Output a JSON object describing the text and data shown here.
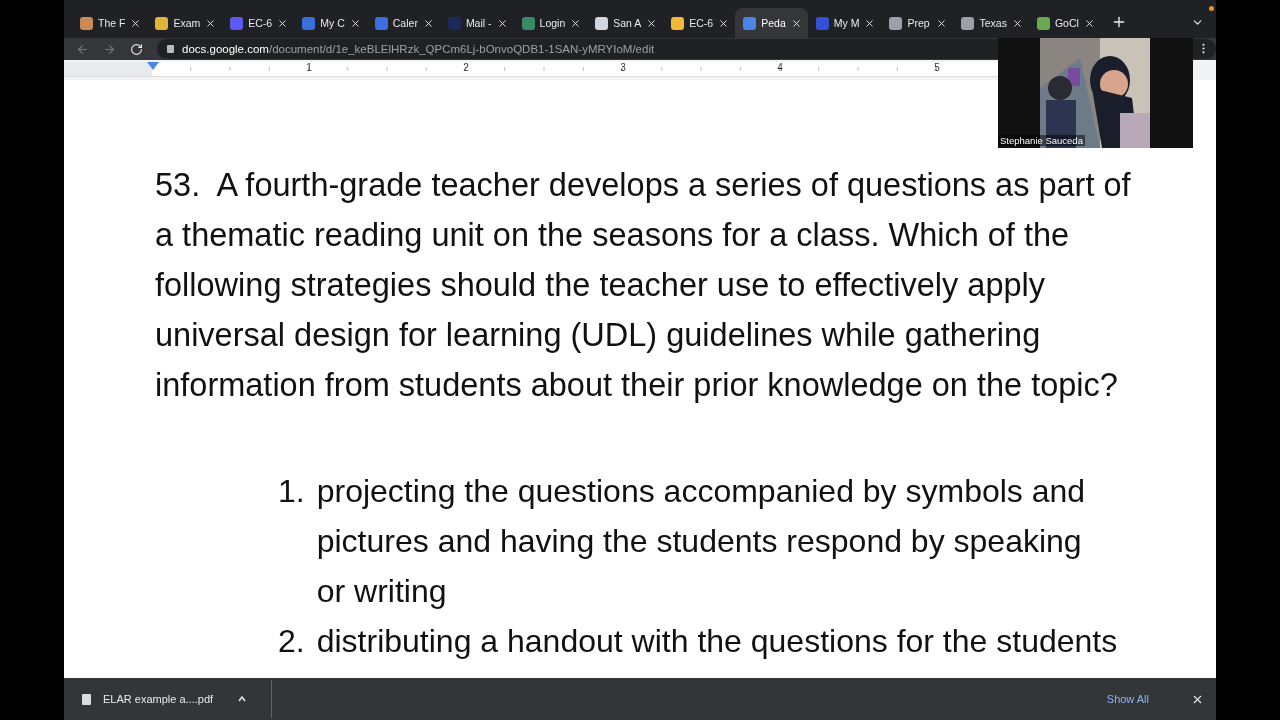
{
  "browser": {
    "tabs": [
      {
        "title": "The F",
        "selected": false,
        "color": "#c98a5a"
      },
      {
        "title": "Exam",
        "selected": false,
        "color": "#e0b43c"
      },
      {
        "title": "EC-6",
        "selected": false,
        "color": "#5b5bf0"
      },
      {
        "title": "My C",
        "selected": false,
        "color": "#3b6fe0"
      },
      {
        "title": "Caler",
        "selected": false,
        "color": "#3b6fe0"
      },
      {
        "title": "Mail -",
        "selected": false,
        "color": "#1c2a5a"
      },
      {
        "title": "Login",
        "selected": false,
        "color": "#3a8a6a"
      },
      {
        "title": "San A",
        "selected": false,
        "color": "#cfd6e0"
      },
      {
        "title": "EC-6",
        "selected": false,
        "color": "#f2b83a"
      },
      {
        "title": "Peda",
        "selected": true,
        "color": "#4a86e8"
      },
      {
        "title": "My M",
        "selected": false,
        "color": "#3550d8"
      },
      {
        "title": "Prep",
        "selected": false,
        "color": "#9aa0a6"
      },
      {
        "title": "Texas",
        "selected": false,
        "color": "#9aa0a6"
      },
      {
        "title": "GoCl",
        "selected": false,
        "color": "#6aa84f"
      }
    ],
    "address": {
      "host": "docs.google.com",
      "path": "/document/d/1e_keBLElHRzk_QPCm6Lj-bOnvoQDB1-1SAN-yMRYIoM/edit"
    }
  },
  "ruler": {
    "marks": [
      "1",
      "2",
      "3",
      "4",
      "5"
    ]
  },
  "document": {
    "question": "53.  A fourth-grade teacher develops a series of questions as part of a thematic reading unit on the seasons for a class. Which of the following strategies should the teacher use to effectively apply universal design for learning (UDL) guidelines while gathering information from students about their prior knowledge on the topic?",
    "options": [
      {
        "number": "1.",
        "text": "projecting the questions accompanied by symbols and pictures and having the students respond by speaking or writing"
      },
      {
        "number": "2.",
        "text": "distributing a handout with the questions for the students"
      }
    ]
  },
  "video": {
    "kind": "picture",
    "name": "Stephanie Sauceda"
  },
  "downloads": {
    "file": "ELAR example a....pdf",
    "show_all": "Show All"
  }
}
